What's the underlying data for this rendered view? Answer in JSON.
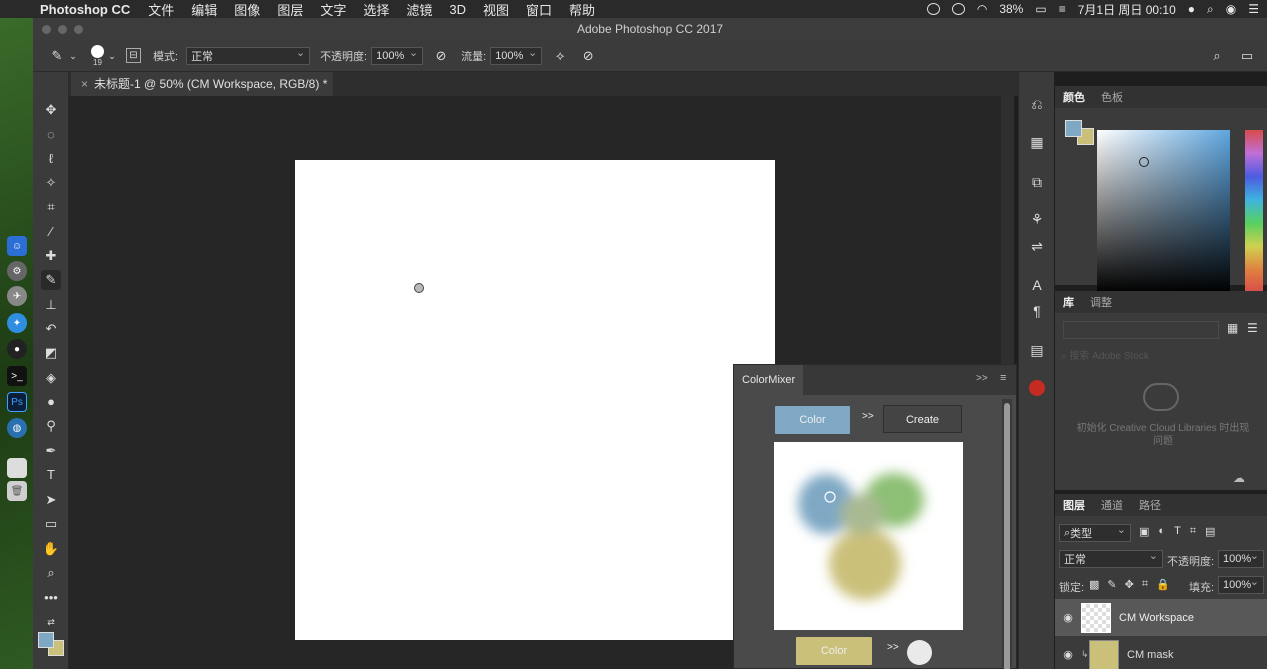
{
  "menubar": {
    "app_name": "Photoshop CC",
    "menus": [
      "文件",
      "编辑",
      "图像",
      "图层",
      "文字",
      "选择",
      "滤镜",
      "3D",
      "视图",
      "窗口",
      "帮助"
    ],
    "battery": "38%",
    "datetime": "7月1日 周日 00:10"
  },
  "window": {
    "title": "Adobe Photoshop CC 2017"
  },
  "options_bar": {
    "brush_size": "19",
    "mode_label": "模式:",
    "mode_value": "正常",
    "opacity_label": "不透明度:",
    "opacity_value": "100%",
    "flow_label": "流量:",
    "flow_value": "100%"
  },
  "document_tab": {
    "title": "未标题-1 @ 50% (CM Workspace, RGB/8) *"
  },
  "color_panel": {
    "tabs": [
      "颜色",
      "色板"
    ],
    "fg_color": "#7fa8c4",
    "bg_color": "#cbc07a"
  },
  "library_panel": {
    "tabs": [
      "库",
      "调整"
    ],
    "search_placeholder": "搜索 Adobe Stock",
    "message": "初始化 Creative Cloud Libraries 时出现问题"
  },
  "layers_panel": {
    "tabs": [
      "图层",
      "通道",
      "路径"
    ],
    "filter_label": "类型",
    "blend_mode": "正常",
    "opacity_label": "不透明度:",
    "opacity_value": "100%",
    "lock_label": "锁定:",
    "fill_label": "填充:",
    "fill_value": "100%",
    "layers": [
      {
        "name": "CM Workspace"
      },
      {
        "name": "CM mask"
      }
    ]
  },
  "colormixer": {
    "title": "ColorMixer",
    "color_button": "Color",
    "arrow": ">>",
    "create_button": "Create",
    "bottom_color_button": "Color",
    "bottom_arrow": ">>",
    "blob_colors": [
      "#7fa8c4",
      "#8dbf75",
      "#cbc07a"
    ]
  }
}
